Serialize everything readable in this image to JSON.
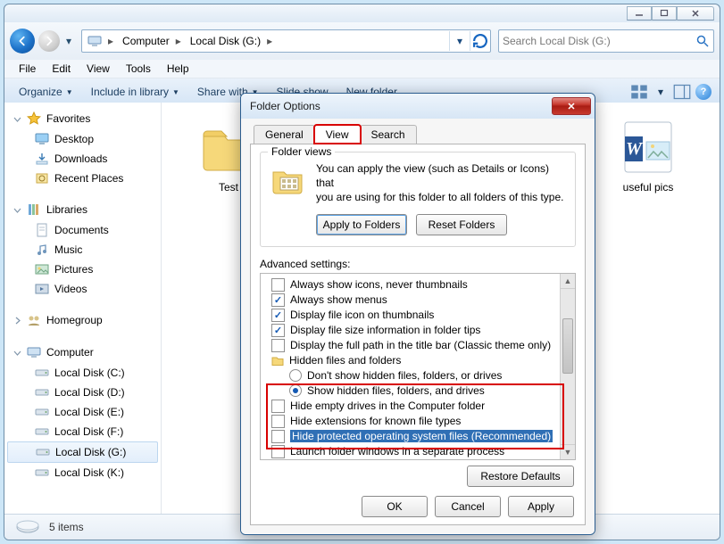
{
  "window": {
    "min": "—",
    "max": "▭",
    "close": "✕"
  },
  "breadcrumb": {
    "computer": "Computer",
    "drive": "Local Disk (G:)"
  },
  "search": {
    "placeholder": "Search Local Disk (G:)"
  },
  "menu": {
    "file": "File",
    "edit": "Edit",
    "view": "View",
    "tools": "Tools",
    "help": "Help"
  },
  "cmd": {
    "organize": "Organize",
    "include": "Include in library",
    "share": "Share with",
    "slideshow": "Slide show",
    "newfolder": "New folder"
  },
  "sidebar": {
    "favorites": "Favorites",
    "fav_items": [
      "Desktop",
      "Downloads",
      "Recent Places"
    ],
    "libraries": "Libraries",
    "lib_items": [
      "Documents",
      "Music",
      "Pictures",
      "Videos"
    ],
    "homegroup": "Homegroup",
    "computer": "Computer",
    "drives": [
      "Local Disk (C:)",
      "Local Disk (D:)",
      "Local Disk (E:)",
      "Local Disk (F:)",
      "Local Disk (G:)",
      "Local Disk (K:)"
    ]
  },
  "content": {
    "items": [
      {
        "label": "Test",
        "type": "folder"
      },
      {
        "label": "useful pics",
        "type": "docx"
      }
    ]
  },
  "status": {
    "text": "5 items"
  },
  "dialog": {
    "title": "Folder Options",
    "close": "✕",
    "tabs": {
      "general": "General",
      "view": "View",
      "search": "Search"
    },
    "fv": {
      "legend": "Folder views",
      "line1": "You can apply the view (such as Details or Icons) that",
      "line2": "you are using for this folder to all folders of this type.",
      "apply": "Apply to Folders",
      "reset": "Reset Folders"
    },
    "adv_label": "Advanced settings:",
    "adv": {
      "r0": "Always show icons, never thumbnails",
      "r1": "Always show menus",
      "r2": "Display file icon on thumbnails",
      "r3": "Display file size information in folder tips",
      "r4": "Display the full path in the title bar (Classic theme only)",
      "r5": "Hidden files and folders",
      "r6": "Don't show hidden files, folders, or drives",
      "r7": "Show hidden files, folders, and drives",
      "r8": "Hide empty drives in the Computer folder",
      "r9": "Hide extensions for known file types",
      "r10": "Hide protected operating system files (Recommended)",
      "r11": "Launch folder windows in a separate process"
    },
    "restore": "Restore Defaults",
    "ok": "OK",
    "cancel": "Cancel",
    "apply": "Apply"
  }
}
